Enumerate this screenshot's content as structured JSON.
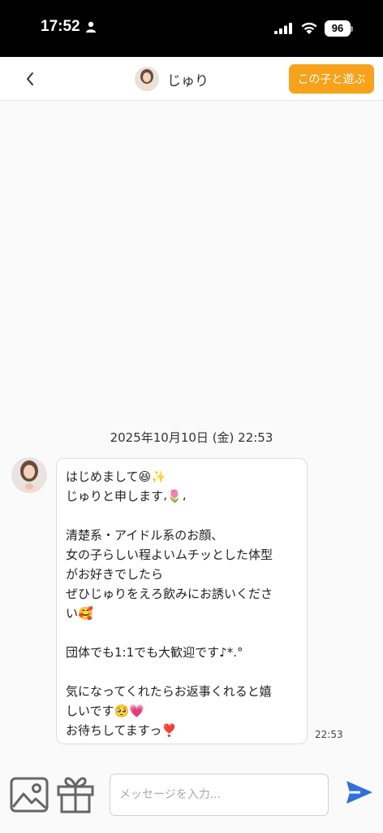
{
  "status_bar": {
    "time": "17:52",
    "battery": "96"
  },
  "header": {
    "title": "じゅり",
    "play_button_label": "この子と遊ぶ"
  },
  "chat": {
    "date_label": "2025年10月10日 (金) 22:53",
    "message": {
      "lines": [
        "はじめまして😆✨",
        "じゅりと申します،🌷،",
        "",
        "清楚系・アイドル系のお顔、",
        "女の子らしい程よいムチッとした体型",
        "がお好きでしたら",
        "ぜひじゅりをえろ飲みにお誘いくださ",
        "い🥰",
        "",
        "団体でも1:1でも大歓迎です♪*.°",
        "",
        "気になってくれたらお返事くれると嬉",
        "しいです🥺💗",
        "お待ちしてますっ❣️"
      ],
      "time": "22:53"
    }
  },
  "input": {
    "placeholder": "メッセージを入力..."
  },
  "colors": {
    "accent": "#f6a21a",
    "send": "#2f6fe0"
  }
}
